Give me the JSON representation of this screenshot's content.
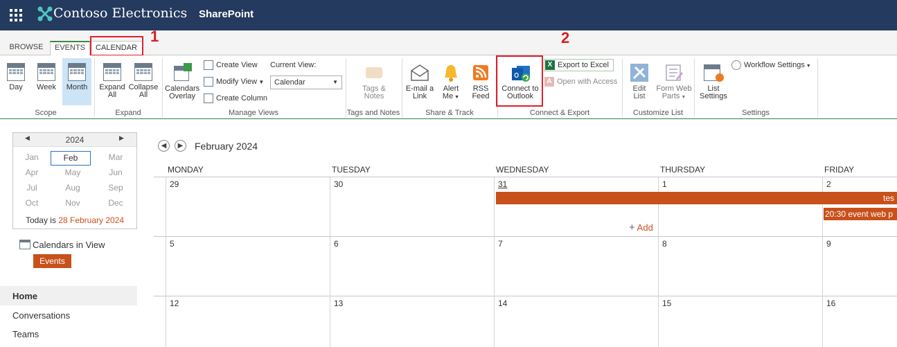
{
  "suite_bar": {
    "brand": "Contoso Electronics",
    "app_name": "SharePoint"
  },
  "ribbon_tabs": {
    "browse": "BROWSE",
    "events": "EVENTS",
    "calendar": "CALENDAR"
  },
  "annotations": {
    "step1": "1",
    "step2": "2",
    "color": "#e0202a"
  },
  "ribbon": {
    "scope": {
      "label": "Scope",
      "day": "Day",
      "week": "Week",
      "month": "Month"
    },
    "expand": {
      "label": "Expand",
      "expand_all_1": "Expand",
      "expand_all_2": "All",
      "collapse_all_1": "Collapse",
      "collapse_all_2": "All"
    },
    "manage_views": {
      "label": "Manage Views",
      "calendars_overlay_1": "Calendars",
      "calendars_overlay_2": "Overlay",
      "create_view": "Create View",
      "modify_view": "Modify View",
      "create_column": "Create Column",
      "current_view_label": "Current View:",
      "current_view_value": "Calendar"
    },
    "tags_notes": {
      "label": "Tags and Notes",
      "tags_1": "Tags &",
      "tags_2": "Notes"
    },
    "share_track": {
      "label": "Share & Track",
      "email_1": "E-mail a",
      "email_2": "Link",
      "alert_1": "Alert",
      "alert_2": "Me",
      "rss_1": "RSS",
      "rss_2": "Feed"
    },
    "connect_export": {
      "label": "Connect & Export",
      "outlook_1": "Connect to",
      "outlook_2": "Outlook",
      "export_excel": "Export to Excel",
      "open_access": "Open with Access"
    },
    "customize_list": {
      "label": "Customize List",
      "edit_1": "Edit",
      "edit_2": "List",
      "form_1": "Form Web",
      "form_2": "Parts"
    },
    "settings": {
      "label": "Settings",
      "list_settings_1": "List",
      "list_settings_2": "Settings",
      "workflow_settings": "Workflow Settings"
    }
  },
  "mini_calendar": {
    "year": "2024",
    "months": [
      "Jan",
      "Feb",
      "Mar",
      "Apr",
      "May",
      "Jun",
      "Jul",
      "Aug",
      "Sep",
      "Oct",
      "Nov",
      "Dec"
    ],
    "selected": "Feb",
    "today_prefix": "Today is",
    "today_date": "28 February 2024"
  },
  "calendars_in_view": {
    "label": "Calendars in View",
    "chip": "Events"
  },
  "left_nav": {
    "home": "Home",
    "conversations": "Conversations",
    "teams": "Teams"
  },
  "calendar": {
    "title": "February 2024",
    "day_headers": [
      "MONDAY",
      "TUESDAY",
      "WEDNESDAY",
      "THURSDAY",
      "FRIDAY"
    ],
    "week1": [
      "29",
      "30",
      "31",
      "1",
      "2"
    ],
    "week2": [
      "5",
      "6",
      "7",
      "8",
      "9"
    ],
    "week3": [
      "12",
      "13",
      "14",
      "15",
      "16"
    ],
    "event_bar": "tes",
    "event_2030": "20:30 event web p",
    "add": "Add"
  },
  "colors": {
    "suite_bar": "#243a5e",
    "event": "#c8501a",
    "accent_green": "#2a8a3a"
  }
}
